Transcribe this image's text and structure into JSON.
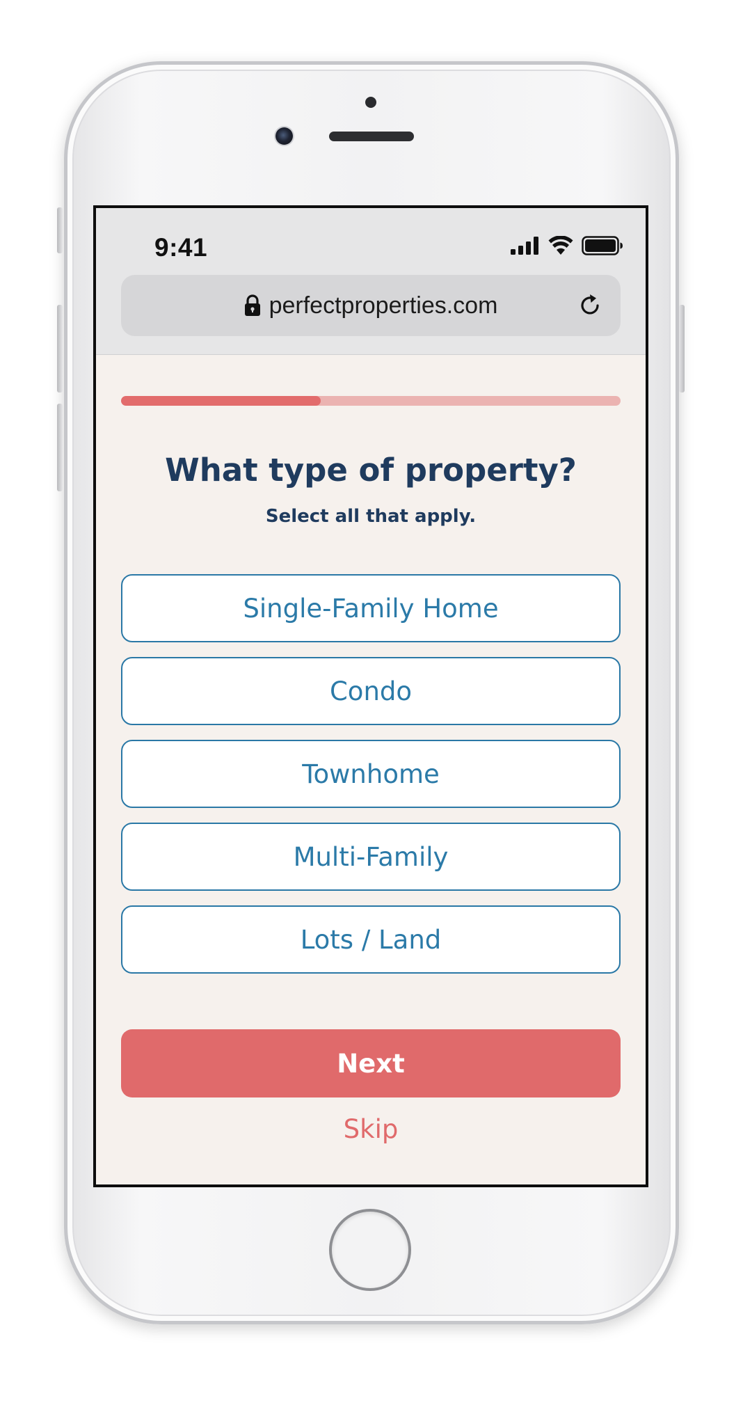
{
  "status_bar": {
    "time": "9:41",
    "icons": [
      "cellular-signal-icon",
      "wifi-icon",
      "battery-icon"
    ]
  },
  "browser": {
    "url": "perfectproperties.com",
    "lock_icon": "lock-icon",
    "reload_icon": "reload-icon"
  },
  "progress": {
    "fraction": 0.4
  },
  "question": {
    "title": "What type of property?",
    "subtitle": "Select all that apply."
  },
  "options": [
    {
      "label": "Single-Family Home"
    },
    {
      "label": "Condo"
    },
    {
      "label": "Townhome"
    },
    {
      "label": "Multi-Family"
    },
    {
      "label": "Lots / Land"
    }
  ],
  "actions": {
    "next_label": "Next",
    "skip_label": "Skip"
  },
  "colors": {
    "accent": "#e06a6b",
    "accent_light": "#ebb3b1",
    "heading": "#1f3b5e",
    "option_border": "#2a78a6",
    "option_text": "#2b7aa8",
    "page_background": "#f6f1ed"
  }
}
